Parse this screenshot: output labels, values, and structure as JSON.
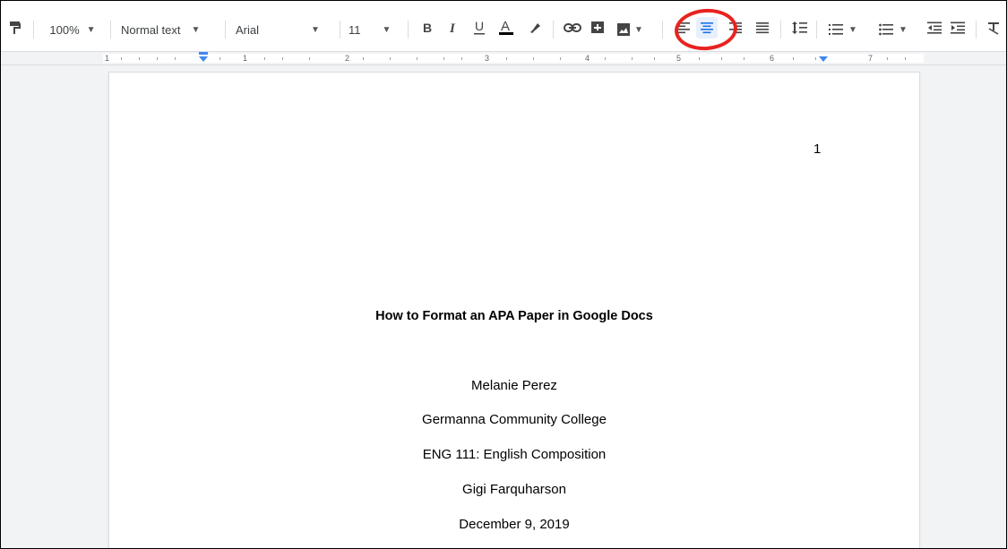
{
  "toolbar": {
    "zoom": "100%",
    "style": "Normal text",
    "font": "Arial",
    "font_size": "11",
    "colors": {
      "text_color_bar": "#000000",
      "accent": "#1a73e8",
      "annotation": "#e8231f"
    }
  },
  "ruler": {
    "marks": [
      "1",
      "1",
      "2",
      "3",
      "4",
      "5",
      "6",
      "7"
    ]
  },
  "document": {
    "page_number": "1",
    "title": "How to Format an APA Paper in Google Docs",
    "author": "Melanie Perez",
    "institution": "Germanna Community College",
    "course": "ENG 111: English Composition",
    "instructor": "Gigi Farquharson",
    "date": "December 9, 2019"
  }
}
